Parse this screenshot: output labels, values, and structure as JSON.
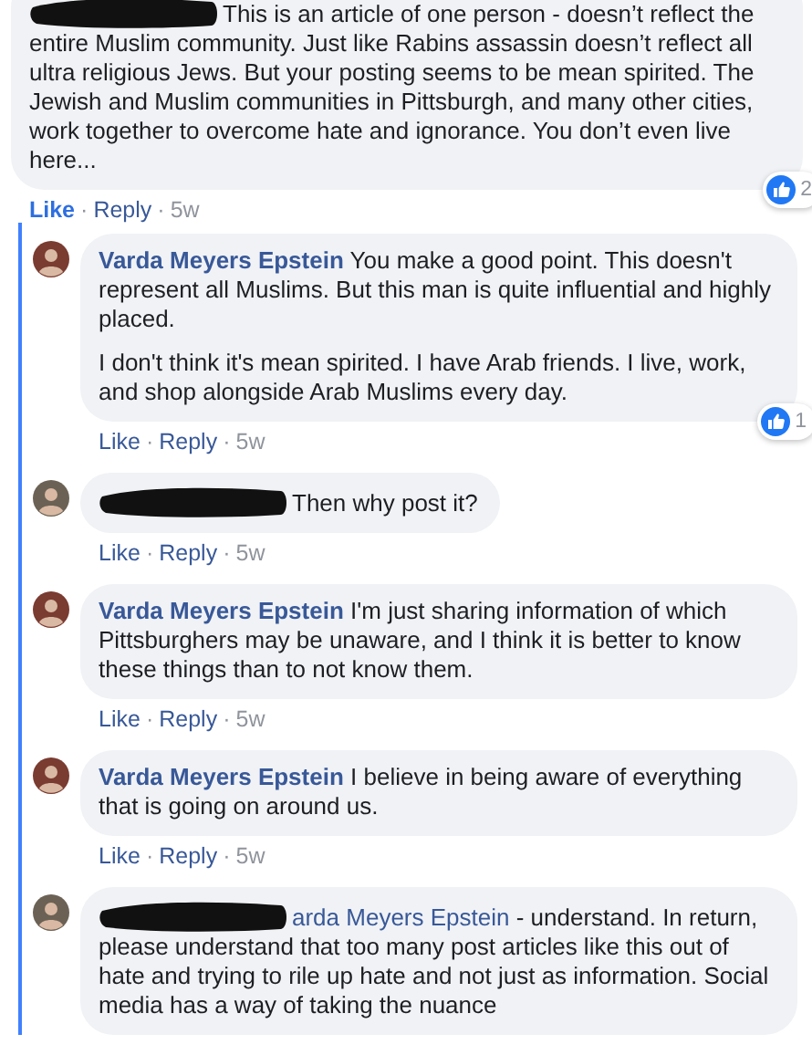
{
  "separator": "·",
  "comments": [
    {
      "kind": "top",
      "author_redacted": true,
      "paragraphs": [
        "This is an article of one person - doesn’t reflect the entire Muslim community. Just like Rabins assassin doesn’t reflect all ultra religious Jews. But your posting seems to be mean spirited. The Jewish and Muslim communities in Pittsburgh, and many other cities, work together to overcome hate and ignorance. You don’t even live here..."
      ],
      "reactions": "2",
      "liked": true,
      "actions": [
        "Like",
        "Reply"
      ],
      "time": "5w"
    },
    {
      "kind": "reply",
      "author_redacted": false,
      "author": "Varda Meyers Epstein",
      "paragraphs": [
        "You make a good point. This doesn't represent all Muslims. But this man is quite influential and highly placed.",
        "I don't think it's mean spirited. I have Arab friends. I live, work, and shop alongside Arab Muslims every day."
      ],
      "reactions": "1",
      "liked": false,
      "actions": [
        "Like",
        "Reply"
      ],
      "time": "5w"
    },
    {
      "kind": "reply",
      "author_redacted": true,
      "paragraphs": [
        "Then why post it?"
      ],
      "liked": false,
      "actions": [
        "Like",
        "Reply"
      ],
      "time": "5w"
    },
    {
      "kind": "reply",
      "author_redacted": false,
      "author": "Varda Meyers Epstein",
      "paragraphs": [
        "I'm just sharing information of which Pittsburghers may be unaware, and I think it is better to know these things than to not know them."
      ],
      "liked": false,
      "actions": [
        "Like",
        "Reply"
      ],
      "time": "5w"
    },
    {
      "kind": "reply",
      "author_redacted": false,
      "author": "Varda Meyers Epstein",
      "paragraphs": [
        "I believe in being aware of everything that is going on around us."
      ],
      "liked": false,
      "actions": [
        "Like",
        "Reply"
      ],
      "time": "5w"
    },
    {
      "kind": "reply",
      "author_redacted": true,
      "mention": "arda Meyers Epstein",
      "paragraphs": [
        "- understand. In return, please understand that too many post articles like this out of hate and trying to rile up hate and not just as information. Social media has a way of taking the nuance"
      ]
    }
  ]
}
